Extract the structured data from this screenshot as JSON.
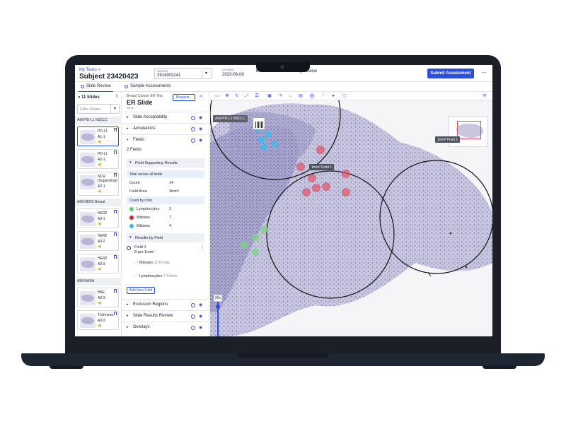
{
  "header": {
    "breadcrumb": "My Tasks >",
    "subject": "Subject 23420423",
    "sample_label": "Sample",
    "sample_value": "3914903241",
    "created_label": "Created",
    "created_value": "2023-06-08",
    "stage_label": "",
    "stage_value": "Enrollment",
    "status_label": "",
    "status_value": "Awaiting Review",
    "submit_label": "Submit Assessment",
    "more_label": "⋯"
  },
  "tabs": [
    {
      "label": "Slide Review"
    },
    {
      "label": "Sample Assessments"
    }
  ],
  "slides": {
    "header": "11 Slides",
    "filter_placeholder": "Filter Slides",
    "groups": [
      {
        "name": "AIM PD-L1 NSCLC"
      },
      {
        "name": "AIM HER2 Breast"
      },
      {
        "name": "AIM NASH"
      }
    ],
    "cards": [
      {
        "stain": "PD-L1",
        "id": "A1-1"
      },
      {
        "stain": "PD-L1",
        "id": "A2-1"
      },
      {
        "stain": "NCR (Supporting)",
        "id": "A2-1"
      },
      {
        "stain": "HER2",
        "id": "A3-1"
      },
      {
        "stain": "HER2",
        "id": "A3-2"
      },
      {
        "stain": "HER2",
        "id": "A3-3"
      },
      {
        "stain": "H&E",
        "id": "A3-3"
      },
      {
        "stain": "Trichrome",
        "id": "A3-3"
      }
    ]
  },
  "assessment": {
    "test_name": "Breast Cancer ER Test",
    "slide_title": "ER Slide",
    "slide_id": "A1-1",
    "request_label": "Request...",
    "sections": [
      {
        "label": "Slide Acceptability"
      },
      {
        "label": "Annotations"
      },
      {
        "label": "Fields"
      }
    ],
    "fields_count": "2 Fields",
    "supporting_title": "Field Supporting Results",
    "total_label": "Total across all fields",
    "count_label": "Count",
    "count_value": "14",
    "area_label": "Field Area",
    "area_value": "3mm²",
    "by_color_label": "Count by color",
    "colors": [
      {
        "name": "Lymphocytes",
        "value": "3",
        "color": "#5ad06a"
      },
      {
        "name": "Mitoses",
        "value": "7",
        "color": "#d0223a"
      },
      {
        "name": "Mitoses",
        "value": "4",
        "color": "#35b7e8"
      }
    ],
    "results_title": "Results by Field",
    "field_name": "Field 1",
    "field_density": "8 per 1mm² ·",
    "point_rows": [
      {
        "name": "Mitoses",
        "points": "11 Points"
      },
      {
        "name": "Lymphocytes",
        "points": "3 Points"
      }
    ],
    "add_field_label": "Add New Field",
    "bottom_sections": [
      {
        "label": "Exclusion Regions"
      },
      {
        "label": "Slide Results Review"
      },
      {
        "label": "Overlays"
      }
    ]
  },
  "viewer": {
    "slide_label": "AIM PD-L1 NSCLC",
    "field_tag_1": "1mm² Field 1",
    "field_tag_2": "1mm² Field 1",
    "zoom_label": "20x"
  }
}
